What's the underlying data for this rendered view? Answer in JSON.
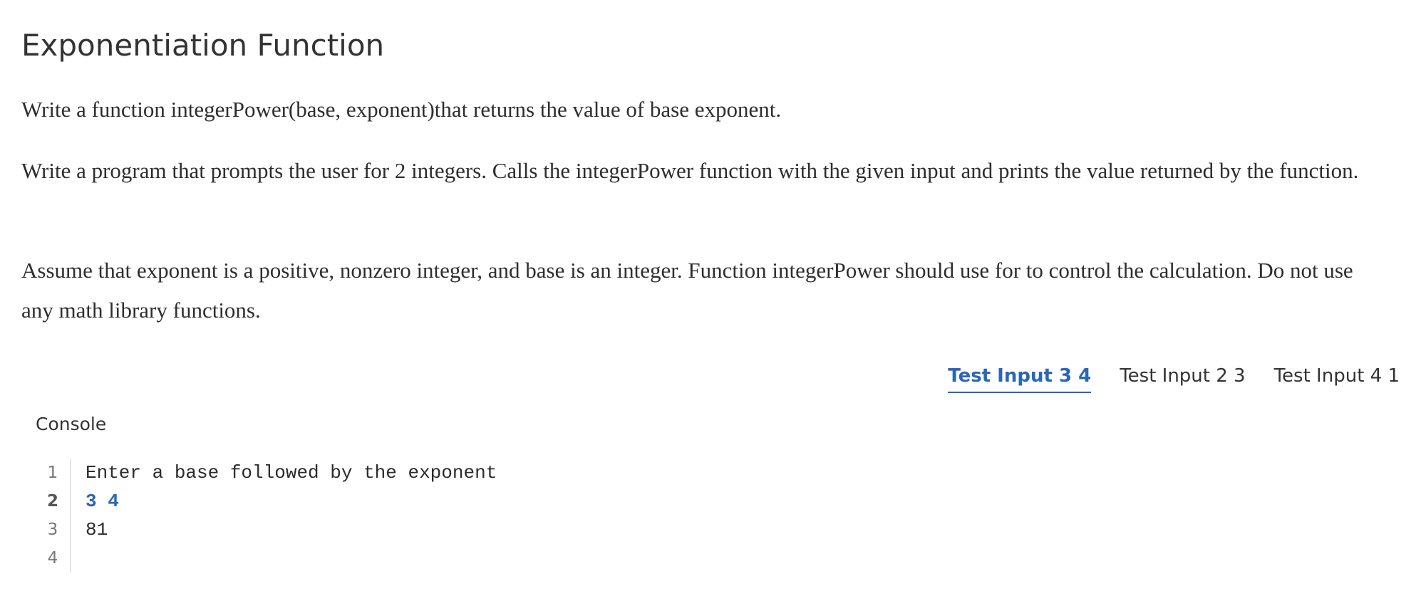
{
  "problem": {
    "title": "Exponentiation Function",
    "paragraphs": [
      "Write a function integerPower(base, exponent)that returns the value of base exponent.",
      "Write a program that prompts the user for 2 integers. Calls the integerPower function with the given input and prints the value returned by the function.",
      "Assume that exponent is a positive, nonzero integer, and base is an integer. Function integerPower should use for to control the calculation. Do not use any math library functions."
    ]
  },
  "tests": {
    "tabs": [
      {
        "label": "Test Input 3 4",
        "active": true
      },
      {
        "label": "Test Input 2 3",
        "active": false
      },
      {
        "label": "Test Input 4 1",
        "active": false
      }
    ]
  },
  "console": {
    "label": "Console",
    "lines": [
      {
        "number": "1",
        "text": "Enter a base followed by the exponent",
        "is_input": false
      },
      {
        "number": "2",
        "text": "3 4",
        "is_input": true
      },
      {
        "number": "3",
        "text": "81",
        "is_input": false
      },
      {
        "number": "4",
        "text": "",
        "is_input": false
      }
    ]
  },
  "colors": {
    "accent": "#2a66b7",
    "text": "#2e2e2e",
    "gutter_border": "#e4e4e4"
  }
}
